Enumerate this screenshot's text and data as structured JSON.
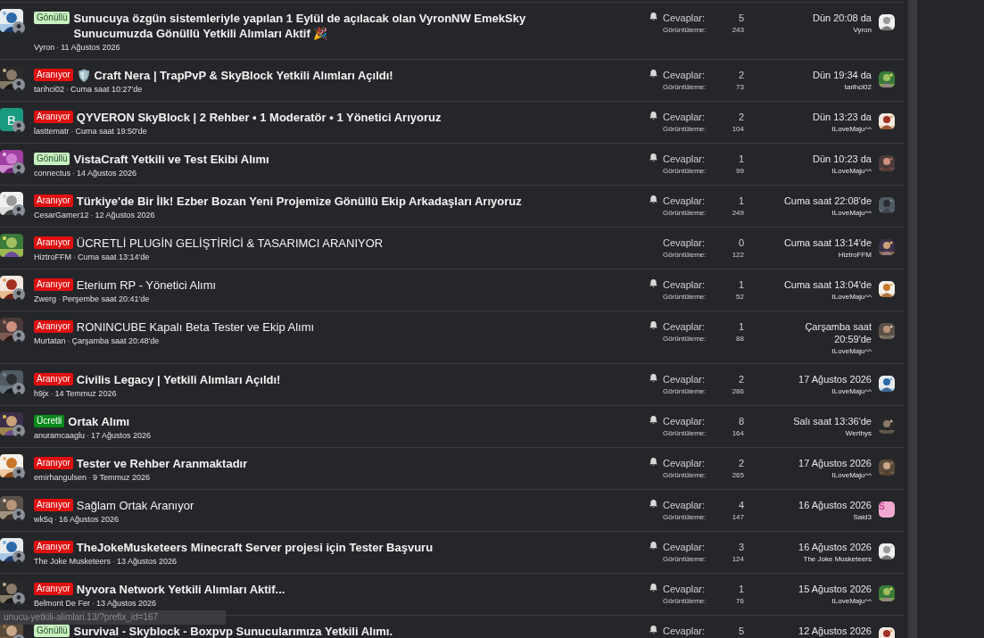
{
  "threads": [
    {
      "mini_avatar": true,
      "prefix": {
        "label": "Gönüllü",
        "kind": "volunteer"
      },
      "title": "Sunucuya özgün sistemleriyle yapılan 1 Eylül de açılacak olan VyronNW EmekSky Sunucumuzda Gönüllü Yetkili Alımları Aktif 🎉",
      "unread": true,
      "author": "Vyron",
      "separator": "·",
      "started": "11 Ağustos 2026",
      "watched": true,
      "replies_label": "Cevaplar:",
      "replies": "5",
      "views_label": "Görüntüleme:",
      "views": "243",
      "last_date": "Dün 20:08 da",
      "last_user": "Vyron"
    },
    {
      "mini_avatar": true,
      "prefix": {
        "label": "Aranıyor",
        "kind": "wanted"
      },
      "title": "🛡️ Craft Nera | TrapPvP & SkyBlock Yetkili Alımları Açıldı!",
      "unread": true,
      "author": "tarihci02",
      "separator": "·",
      "started": "Cuma saat 10:27'de",
      "watched": true,
      "replies_label": "Cevaplar:",
      "replies": "2",
      "views_label": "Görüntüleme:",
      "views": "73",
      "last_date": "Dün 19:34 da",
      "last_user": "tarihci02"
    },
    {
      "avatar": {
        "kind": "letter",
        "letter": "B",
        "color": "#1a9a80"
      },
      "mini_avatar": true,
      "prefix": {
        "label": "Aranıyor",
        "kind": "wanted"
      },
      "title": "QYVERON SkyBlock | 2 Rehber • 1 Moderatör • 1 Yönetici Arıyoruz",
      "unread": true,
      "author": "lasttematr",
      "separator": "·",
      "started": "Cuma saat 19:50'de",
      "watched": true,
      "replies_label": "Cevaplar:",
      "replies": "2",
      "views_label": "Görüntüleme:",
      "views": "104",
      "last_date": "Dün 13:23 da",
      "last_user": "ILoveMaju^^"
    },
    {
      "mini_avatar": true,
      "prefix": {
        "label": "Gönüllü",
        "kind": "volunteer"
      },
      "title": "VistaCraft Yetkili ve Test Ekibi Alımı",
      "unread": true,
      "author": "connectus",
      "separator": "·",
      "started": "14 Ağustos 2026",
      "watched": true,
      "replies_label": "Cevaplar:",
      "replies": "1",
      "views_label": "Görüntüleme:",
      "views": "99",
      "last_date": "Dün 10:23 da",
      "last_user": "ILoveMaju^^"
    },
    {
      "mini_avatar": true,
      "prefix": {
        "label": "Aranıyor",
        "kind": "wanted"
      },
      "title": "Türkiye'de Bir İlk! Ezber Bozan Yeni Projemize Gönüllü Ekip Arkadaşları Arıyoruz",
      "unread": true,
      "author": "CesarGamer12",
      "separator": "·",
      "started": "12 Ağustos 2026",
      "watched": true,
      "replies_label": "Cevaplar:",
      "replies": "1",
      "views_label": "Görüntüleme:",
      "views": "249",
      "last_date": "Cuma saat 22:08'de",
      "last_user": "ILoveMaju^^"
    },
    {
      "mini_avatar": false,
      "prefix": {
        "label": "Aranıyor",
        "kind": "wanted"
      },
      "title": "ÜCRETLİ PLUGİN GELİŞTİRİCİ & TASARIMCI ARANIYOR",
      "unread": false,
      "author": "HiztroFFM",
      "separator": "·",
      "started": "Cuma saat 13:14'de",
      "watched": false,
      "replies_label": "Cevaplar:",
      "replies": "0",
      "views_label": "Görüntüleme:",
      "views": "122",
      "last_date": "Cuma saat 13:14'de",
      "last_user": "HiztroFFM"
    },
    {
      "mini_avatar": true,
      "prefix": {
        "label": "Aranıyor",
        "kind": "wanted"
      },
      "title": "Eterium RP - Yönetici Alımı",
      "unread": false,
      "author": "Zwerg",
      "separator": "·",
      "started": "Perşembe saat 20:41'de",
      "watched": true,
      "replies_label": "Cevaplar:",
      "replies": "1",
      "views_label": "Görüntüleme:",
      "views": "52",
      "last_date": "Cuma saat 13:04'de",
      "last_user": "ILoveMaju^^"
    },
    {
      "mini_avatar": true,
      "prefix": {
        "label": "Aranıyor",
        "kind": "wanted"
      },
      "title": "RONINCUBE Kapalı Beta Tester ve Ekip Alımı",
      "unread": false,
      "author": "Murtatan",
      "separator": "·",
      "started": "Çarşamba saat 20:48'de",
      "watched": true,
      "replies_label": "Cevaplar:",
      "replies": "1",
      "views_label": "Görüntüleme:",
      "views": "88",
      "last_date": "Çarşamba saat 20:59'de",
      "last_user": "ILoveMaju^^"
    },
    {
      "mini_avatar": true,
      "prefix": {
        "label": "Aranıyor",
        "kind": "wanted"
      },
      "title": "Civilis Legacy | Yetkili Alımları Açıldı!",
      "unread": true,
      "author": "h9jx",
      "separator": "·",
      "started": "14 Temmuz 2026",
      "watched": true,
      "replies_label": "Cevaplar:",
      "replies": "2",
      "views_label": "Görüntüleme:",
      "views": "286",
      "last_date": "17 Ağustos 2026",
      "last_user": "ILoveMaju^^"
    },
    {
      "mini_avatar": true,
      "prefix": {
        "label": "Ücretli",
        "kind": "paid"
      },
      "title": "Ortak Alımı",
      "unread": true,
      "author": "anuramcaaglu",
      "separator": "·",
      "started": "17 Ağustos 2026",
      "watched": true,
      "replies_label": "Cevaplar:",
      "replies": "8",
      "views_label": "Görüntüleme:",
      "views": "164",
      "last_date": "Salı saat 13:36'de",
      "last_user": "Werthys"
    },
    {
      "mini_avatar": true,
      "prefix": {
        "label": "Aranıyor",
        "kind": "wanted"
      },
      "title": "Tester ve Rehber Aranmaktadır",
      "unread": true,
      "author": "emirhangulsen",
      "separator": "·",
      "started": "9 Temmuz 2026",
      "watched": true,
      "replies_label": "Cevaplar:",
      "replies": "2",
      "views_label": "Görüntüleme:",
      "views": "265",
      "last_date": "17 Ağustos 2026",
      "last_user": "ILoveMaju^^"
    },
    {
      "mini_avatar": true,
      "prefix": {
        "label": "Aranıyor",
        "kind": "wanted"
      },
      "title": "Sağlam Ortak Aranıyor",
      "unread": false,
      "author": "wk5q",
      "separator": "·",
      "started": "16 Ağustos 2026",
      "watched": true,
      "replies_label": "Cevaplar:",
      "replies": "4",
      "views_label": "Görüntüleme:",
      "views": "147",
      "last_date": "16 Ağustos 2026",
      "last_user": "Said3",
      "last_avatar": {
        "kind": "letter",
        "letter": "S",
        "color": "#f0a8d0"
      }
    },
    {
      "mini_avatar": true,
      "prefix": {
        "label": "Aranıyor",
        "kind": "wanted"
      },
      "title": "TheJokeMusketeers Minecraft Server projesi için Tester Başvuru",
      "unread": true,
      "author": "The Joke Musketeers",
      "separator": "·",
      "started": "13 Ağustos 2026",
      "watched": true,
      "replies_label": "Cevaplar:",
      "replies": "3",
      "views_label": "Görüntüleme:",
      "views": "124",
      "last_date": "16 Ağustos 2026",
      "last_user": "The Joke Musketeers"
    },
    {
      "mini_avatar": true,
      "prefix": {
        "label": "Aranıyor",
        "kind": "wanted"
      },
      "title": "Nyvora Network Yetkili Alımları Aktif...",
      "unread": true,
      "author": "Belmont De Fer",
      "separator": "·",
      "started": "13 Ağustos 2026",
      "watched": true,
      "replies_label": "Cevaplar:",
      "replies": "1",
      "views_label": "Görüntüleme:",
      "views": "76",
      "last_date": "15 Ağustos 2026",
      "last_user": "ILoveMaju^^"
    },
    {
      "mini_avatar": true,
      "prefix": {
        "label": "Gönüllü",
        "kind": "volunteer"
      },
      "title": "Survival - Skyblock - Boxpvp Sunucularımıza Yetkili Alımı.",
      "unread": true,
      "watched": true,
      "replies_label": "Cevaplar:",
      "replies": "5",
      "last_date": "12 Ağustos 2026"
    }
  ],
  "status_url": "unucu-yetkili-alimlari.13/?prefix_id=167"
}
